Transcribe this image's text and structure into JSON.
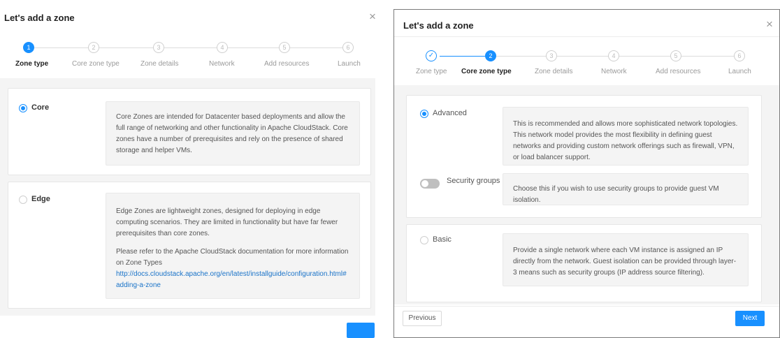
{
  "left": {
    "title": "Let's add a zone",
    "close_glyph": "×",
    "steps": [
      {
        "num": "1",
        "label": "Zone type",
        "state": "active"
      },
      {
        "num": "2",
        "label": "Core zone type",
        "state": "wait"
      },
      {
        "num": "3",
        "label": "Zone details",
        "state": "wait"
      },
      {
        "num": "4",
        "label": "Network",
        "state": "wait"
      },
      {
        "num": "5",
        "label": "Add resources",
        "state": "wait"
      },
      {
        "num": "6",
        "label": "Launch",
        "state": "wait"
      }
    ],
    "core": {
      "label": "Core",
      "selected": true,
      "desc": "Core Zones are intended for Datacenter based deployments and allow the full range of networking and other functionality in Apache CloudStack. Core zones have a number of prerequisites and rely on the presence of shared storage and helper VMs."
    },
    "edge": {
      "label": "Edge",
      "selected": false,
      "desc": "Edge Zones are lightweight zones, designed for deploying in edge computing scenarios. They are limited in functionality but have far fewer prerequisites than core zones.",
      "doc_note": "Please refer to the Apache CloudStack documentation for more information on Zone Types",
      "doc_link": "http://docs.cloudstack.apache.org/en/latest/installguide/configuration.html#adding-a-zone"
    }
  },
  "right": {
    "title": "Let's add a zone",
    "close_glyph": "×",
    "done_glyph": "✓",
    "steps": [
      {
        "num": "1",
        "label": "Zone type",
        "state": "done"
      },
      {
        "num": "2",
        "label": "Core zone type",
        "state": "active"
      },
      {
        "num": "3",
        "label": "Zone details",
        "state": "wait"
      },
      {
        "num": "4",
        "label": "Network",
        "state": "wait"
      },
      {
        "num": "5",
        "label": "Add resources",
        "state": "wait"
      },
      {
        "num": "6",
        "label": "Launch",
        "state": "wait"
      }
    ],
    "advanced": {
      "label": "Advanced",
      "selected": true,
      "desc": "This is recommended and allows more sophisticated network topologies. This network model provides the most flexibility in defining guest networks and providing custom network offerings such as firewall, VPN, or load balancer support."
    },
    "security_groups": {
      "label": "Security groups",
      "enabled": false,
      "desc": "Choose this if you wish to use security groups to provide guest VM isolation."
    },
    "basic": {
      "label": "Basic",
      "selected": false,
      "desc": "Provide a single network where each VM instance is assigned an IP directly from the network. Guest isolation can be provided through layer-3 means such as security groups (IP address source filtering)."
    },
    "previous_label": "Previous",
    "next_label": "Next"
  },
  "colors": {
    "accent": "#1890ff",
    "link": "#1a73c8",
    "panel_bg": "#f4f4f4"
  }
}
